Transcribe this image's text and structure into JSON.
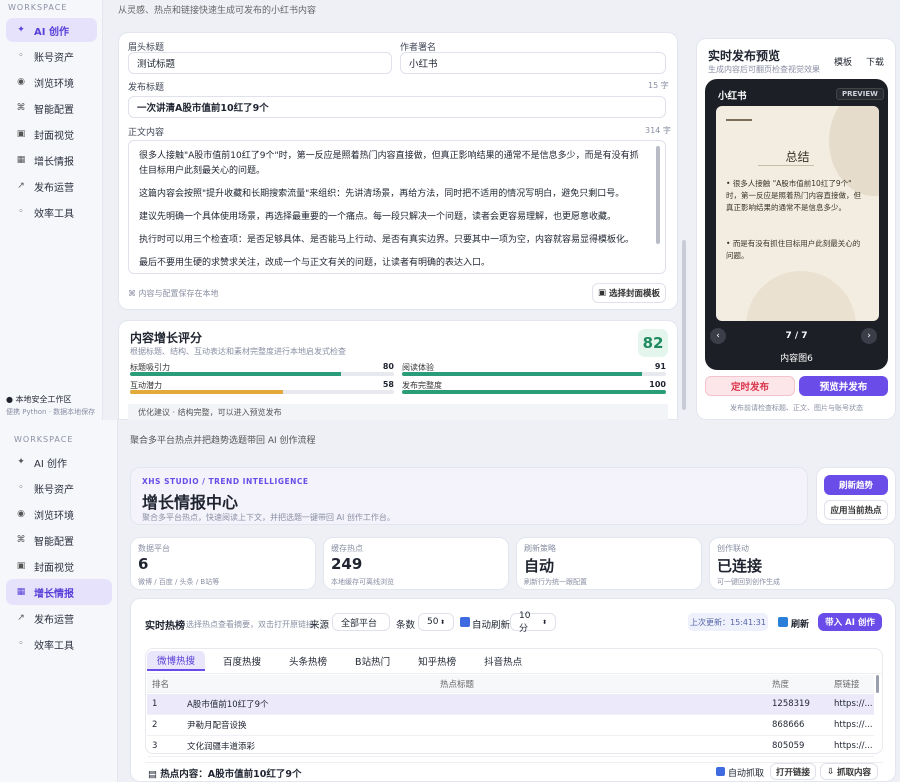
{
  "top": {
    "sidebar": {
      "workspace": "WORKSPACE",
      "items": [
        {
          "label": "AI 创作",
          "icon": "sparkle-icon",
          "active": true
        },
        {
          "label": "账号资产",
          "icon": "dot-icon"
        },
        {
          "label": "浏览环境",
          "icon": "globe-icon"
        },
        {
          "label": "智能配置",
          "icon": "command-icon"
        },
        {
          "label": "封面视觉",
          "icon": "image-icon"
        },
        {
          "label": "增长情报",
          "icon": "grid-icon"
        },
        {
          "label": "发布运营",
          "icon": "arrow-icon"
        },
        {
          "label": "效率工具",
          "icon": "dot-icon"
        }
      ],
      "footer_title": "本地安全工作区",
      "footer_sub": "便携 Python · 数据本地保存"
    },
    "subtitle": "从灵感、热点和链接快速生成可发布的小红书内容",
    "form": {
      "head_title_label": "眉头标题",
      "head_title_value": "测试标题",
      "author_label": "作者署名",
      "author_value": "小红书",
      "pub_title_label": "发布标题",
      "pub_title_count": "15 字",
      "pub_title_value": "一次讲清A股市值前10红了9个",
      "body_label": "正文内容",
      "body_count": "314 字",
      "body_paragraphs": [
        "很多人接触\"A股市值前10红了9个\"时，第一反应是照着热门内容直接做，但真正影响结果的通常不是信息多少，而是有没有抓住目标用户此刻最关心的问题。",
        "这篇内容会按照\"提升收藏和长期搜索流量\"来组织：先讲清场景，再给方法，同时把不适用的情况写明白，避免只剩口号。",
        "建议先明确一个具体使用场景，再选择最重要的一个痛点。每一段只解决一个问题，读者会更容易理解，也更愿意收藏。",
        "执行时可以用三个检查项：是否足够具体、是否能马上行动、是否有真实边界。只要其中一项为空，内容就容易显得模板化。",
        "最后不要用生硬的求赞求关注，改成一个与正文有关的问题，让读者有明确的表达入口。"
      ],
      "save_hint": "内容与配置保存在本地",
      "cover_btn": "选择封面模板"
    },
    "score": {
      "title": "内容增长评分",
      "sub": "根据标题、结构、互动表达和素材完整度进行本地启发式检查",
      "value": "82",
      "items": [
        {
          "name": "标题吸引力",
          "value": 80,
          "color": "#2a9d78"
        },
        {
          "name": "阅读体验",
          "value": 91,
          "color": "#2a9d78"
        },
        {
          "name": "互动潜力",
          "value": 58,
          "color": "#e2a93b"
        },
        {
          "name": "发布完整度",
          "value": 100,
          "color": "#2a9d78"
        }
      ],
      "advice": "优化建议 · 结构完整，可以进入预览发布"
    },
    "preview": {
      "title": "实时发布预览",
      "sub": "生成内容后可翻页检查视觉效果",
      "tab1": "模板",
      "tab2": "下载",
      "app": "小红书",
      "badge": "PREVIEW",
      "card_title": "总结",
      "bullets": [
        "很多人接触 \"A股市值前10红了9个\" 时，第一反应是照着热门内容直接做，但真正影响结果的通常不是信息多少。",
        "而是有没有抓住目标用户此刻最关心的问题。"
      ],
      "page": "7 / 7",
      "page_label": "内容图6",
      "schedule_btn": "定时发布",
      "publish_btn": "预览并发布",
      "note": "发布前请检查标题、正文、图片与账号状态"
    }
  },
  "bottom": {
    "sidebar": {
      "workspace": "WORKSPACE",
      "items": [
        {
          "label": "AI 创作",
          "icon": "sparkle-icon"
        },
        {
          "label": "账号资产",
          "icon": "dot-icon"
        },
        {
          "label": "浏览环境",
          "icon": "globe-icon"
        },
        {
          "label": "智能配置",
          "icon": "command-icon"
        },
        {
          "label": "封面视觉",
          "icon": "image-icon"
        },
        {
          "label": "增长情报",
          "icon": "grid-icon",
          "active": true
        },
        {
          "label": "发布运营",
          "icon": "arrow-icon"
        },
        {
          "label": "效率工具",
          "icon": "dot-icon"
        }
      ]
    },
    "header_sub": "聚合多平台热点并把趋势选题带回 AI 创作流程",
    "hero": {
      "eyebrow": "XHS STUDIO / TREND INTELLIGENCE",
      "title": "增长情报中心",
      "sub": "聚合多平台热点，快速阅读上下文，并把选题一键带回 AI 创作工作台。",
      "refresh_btn": "刷新趋势",
      "apply_btn": "应用当前热点"
    },
    "stats": [
      {
        "label": "数据平台",
        "value": "6",
        "sub": "微博 / 百度 / 头条 / B站等"
      },
      {
        "label": "缓存热点",
        "value": "249",
        "sub": "本地缓存可离线浏览"
      },
      {
        "label": "刷新策略",
        "value": "自动",
        "sub": "刷新行为统一跟配置"
      },
      {
        "label": "创作联动",
        "value": "已连接",
        "sub": "可一键回到创作生成"
      }
    ],
    "toolbar": {
      "title": "实时热榜",
      "hint": "选择热点查看摘要，双击打开原链接",
      "source_label": "来源",
      "source_value": "全部平台",
      "count_label": "条数",
      "count_value": "50",
      "auto_label": "自动刷新",
      "interval_value": "10 分",
      "updated": "上次更新：15:41:31",
      "refresh": "刷新",
      "import": "带入 AI 创作"
    },
    "tabs": [
      "微博热搜",
      "百度热搜",
      "头条热榜",
      "B站热门",
      "知乎热榜",
      "抖音热点"
    ],
    "table": {
      "headers": [
        "排名",
        "热点标题",
        "热度",
        "原链接"
      ],
      "rows": [
        [
          "1",
          "A股市值前10红了9个",
          "1258319",
          "https://..."
        ],
        [
          "2",
          "尹勒月配音设换",
          "868666",
          "https://..."
        ],
        [
          "3",
          "文化润疆丰道添彩",
          "805059",
          "https://..."
        ]
      ]
    },
    "footer": {
      "title": "热点内容：A股市值前10红了9个",
      "auto": "自动抓取",
      "open": "打开链接",
      "fetch": "抓取内容"
    }
  }
}
